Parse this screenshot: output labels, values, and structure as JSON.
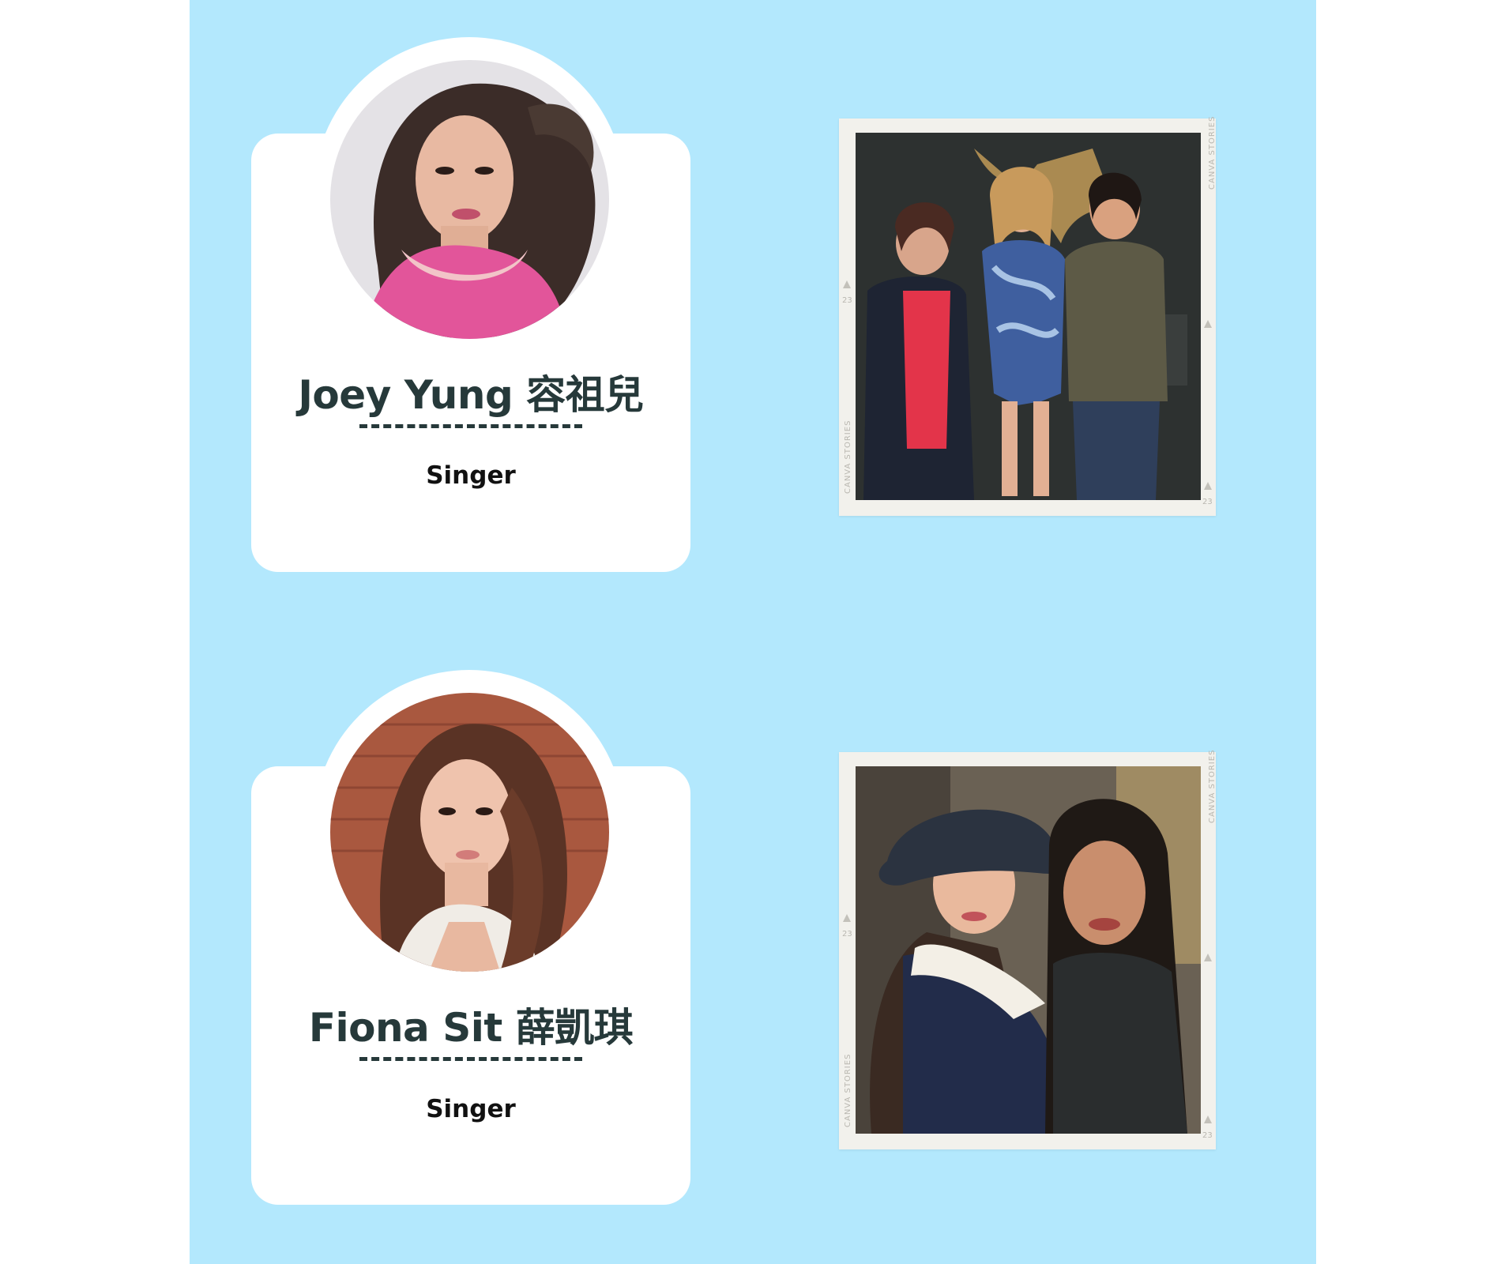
{
  "profiles": [
    {
      "name": "Joey Yung 容祖兒",
      "divider": "-----------",
      "role": "Singer"
    },
    {
      "name": "Fiona Sit 薛凱琪",
      "divider": "-----------",
      "role": "Singer"
    }
  ],
  "photo_frames": {
    "brand": "CANVA STORIES",
    "frame_number": "23"
  },
  "colors": {
    "panel_background": "#b3e8fd",
    "card_background": "#ffffff",
    "name_text": "#26393a",
    "role_text": "#111111",
    "polaroid_border": "#f2f1ec"
  }
}
